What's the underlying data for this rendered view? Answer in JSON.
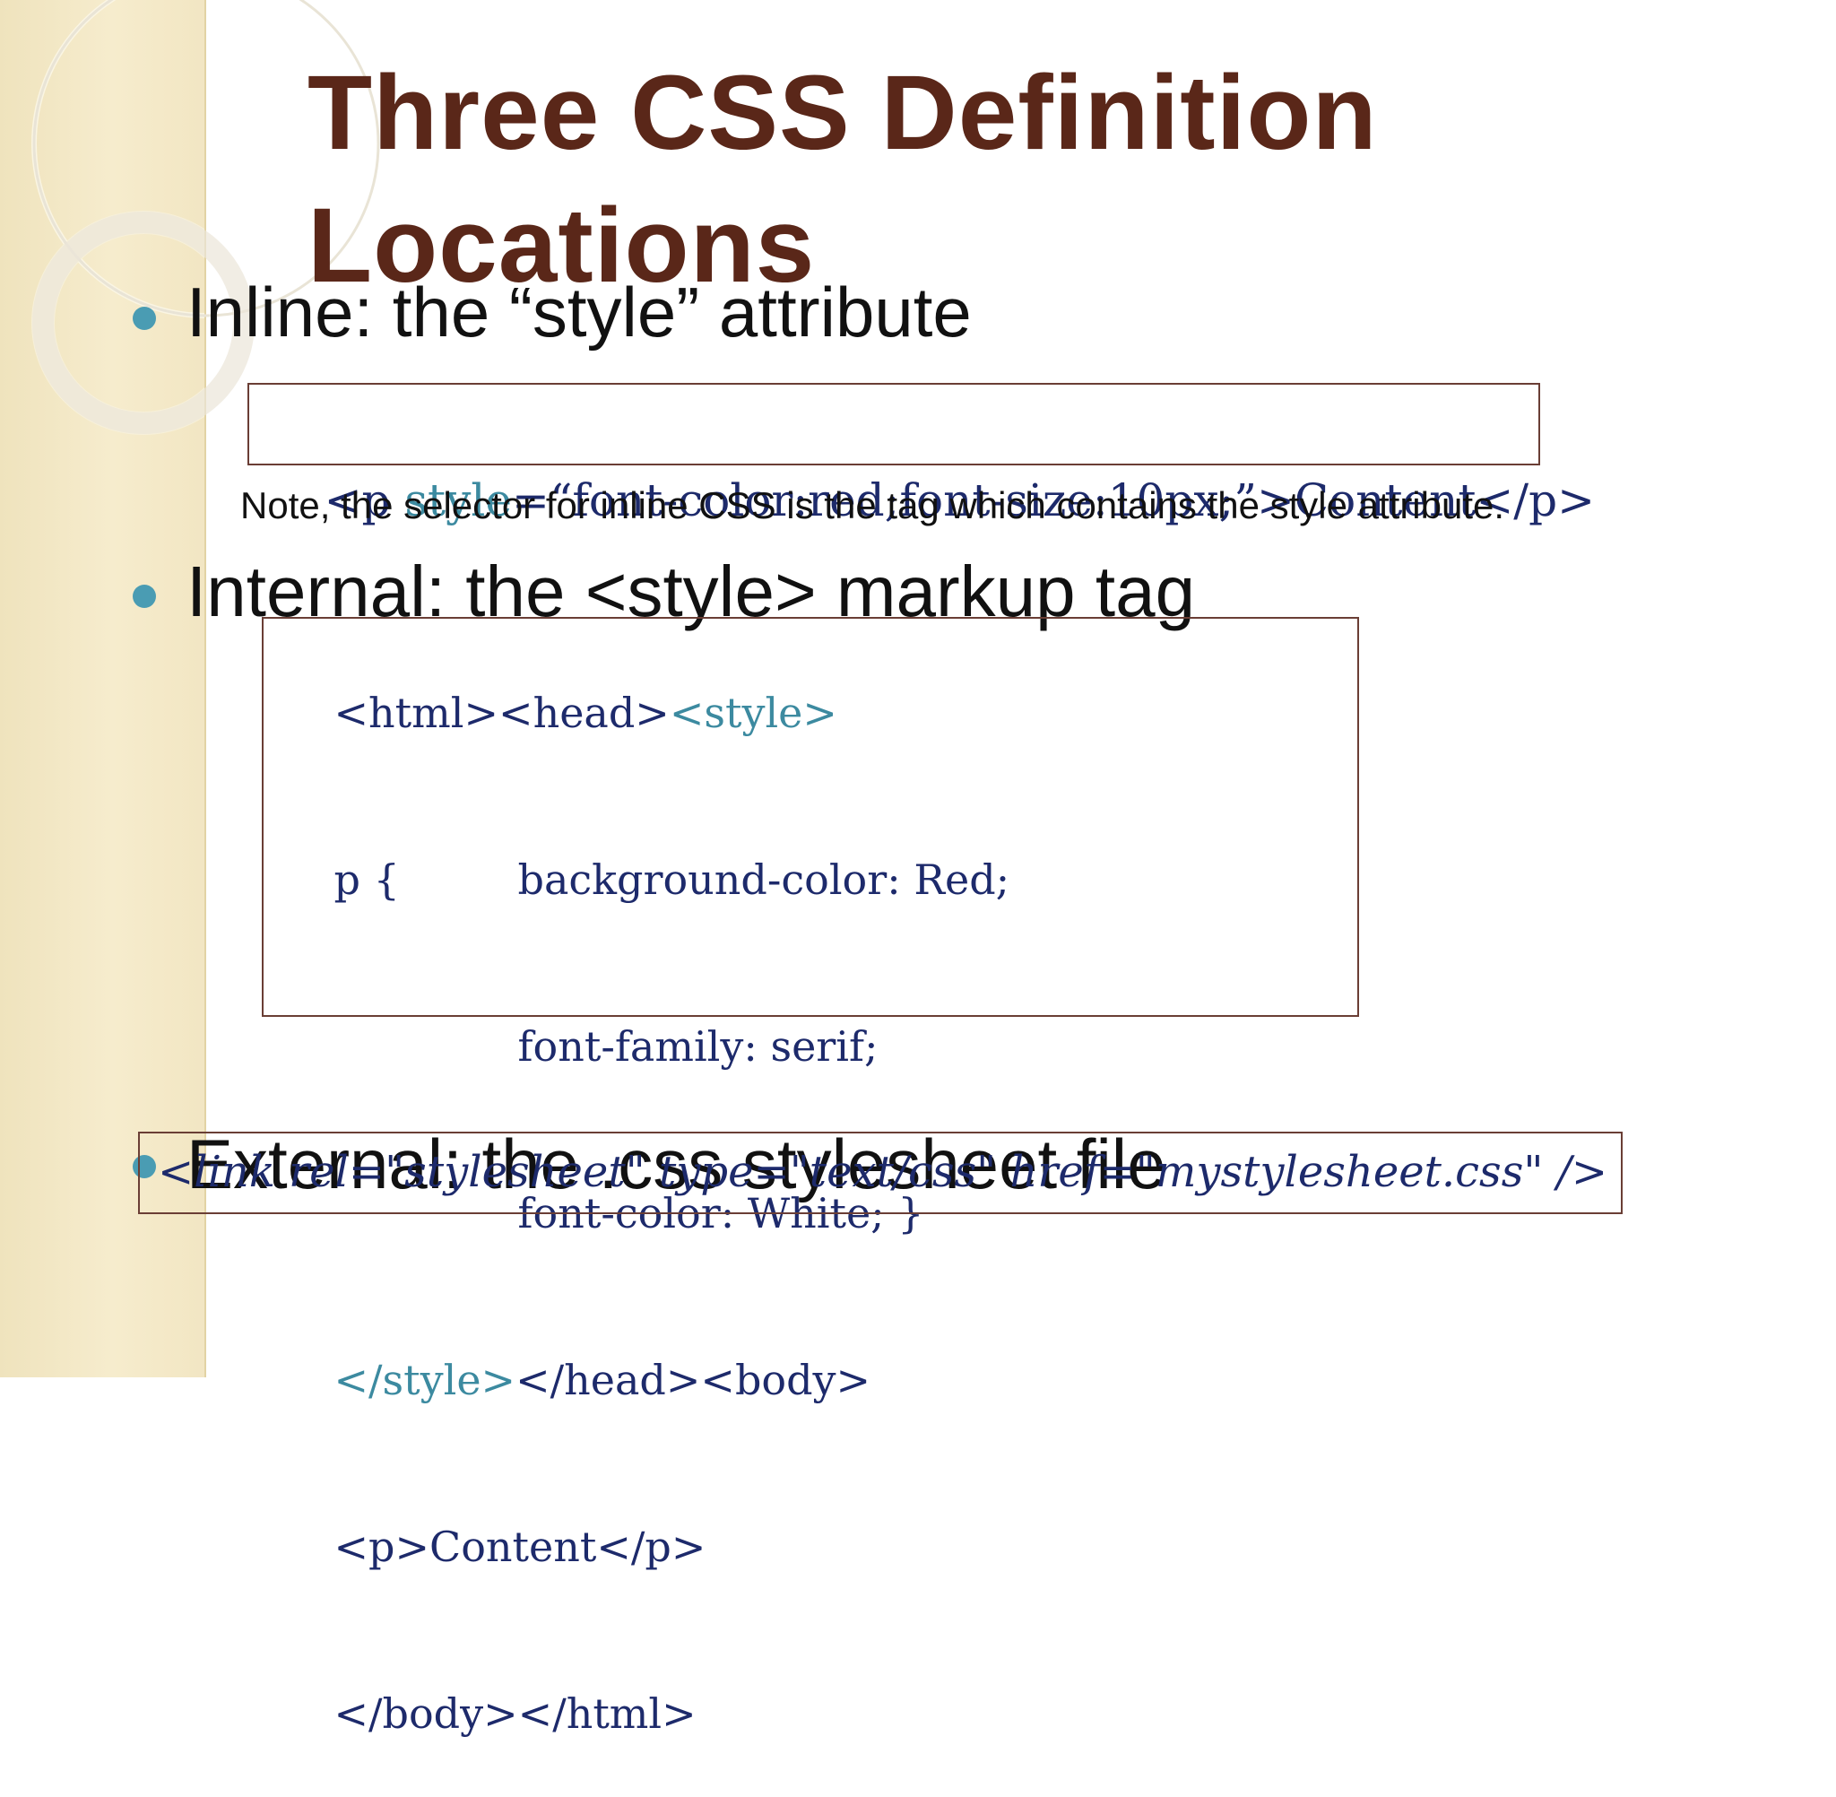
{
  "slide": {
    "title_line1": "Three CSS Definition",
    "title_line2": "Locations"
  },
  "bullets": [
    {
      "label": "Inline:  the “style” attribute"
    },
    {
      "label": "Internal: the <style> markup tag"
    },
    {
      "label": "External: the .css stylesheet file"
    }
  ],
  "inline": {
    "code_part1": "<p ",
    "code_attr": "style",
    "code_part2": "=“font-color:red;font-size:10px;”>Content</p>",
    "note": "Note, the selector for inline CSS is the tag which contains the style attribute."
  },
  "internal": {
    "line1_a": "<html><head>",
    "line1_b": "<style>",
    "line2_a": "p {",
    "line2_b": "background-color: Red;",
    "line3": "font-family: serif;",
    "line4": "font-color: White; }",
    "line5_a": "</style>",
    "line5_b": "</head><body>",
    "line6": "<p>Content</p>",
    "line7": "</body></html>"
  },
  "external": {
    "code": "<link rel=\"stylesheet\" type=\"text/css\" href=\"mystylesheet.css\" />"
  },
  "colors": {
    "title": "#5a2719",
    "bullet": "#4a9cb3",
    "code_text": "#1d2a6b",
    "code_keyword": "#3c8aa0",
    "box_border": "#6a3e35",
    "side_band": "#f2e6c3"
  }
}
